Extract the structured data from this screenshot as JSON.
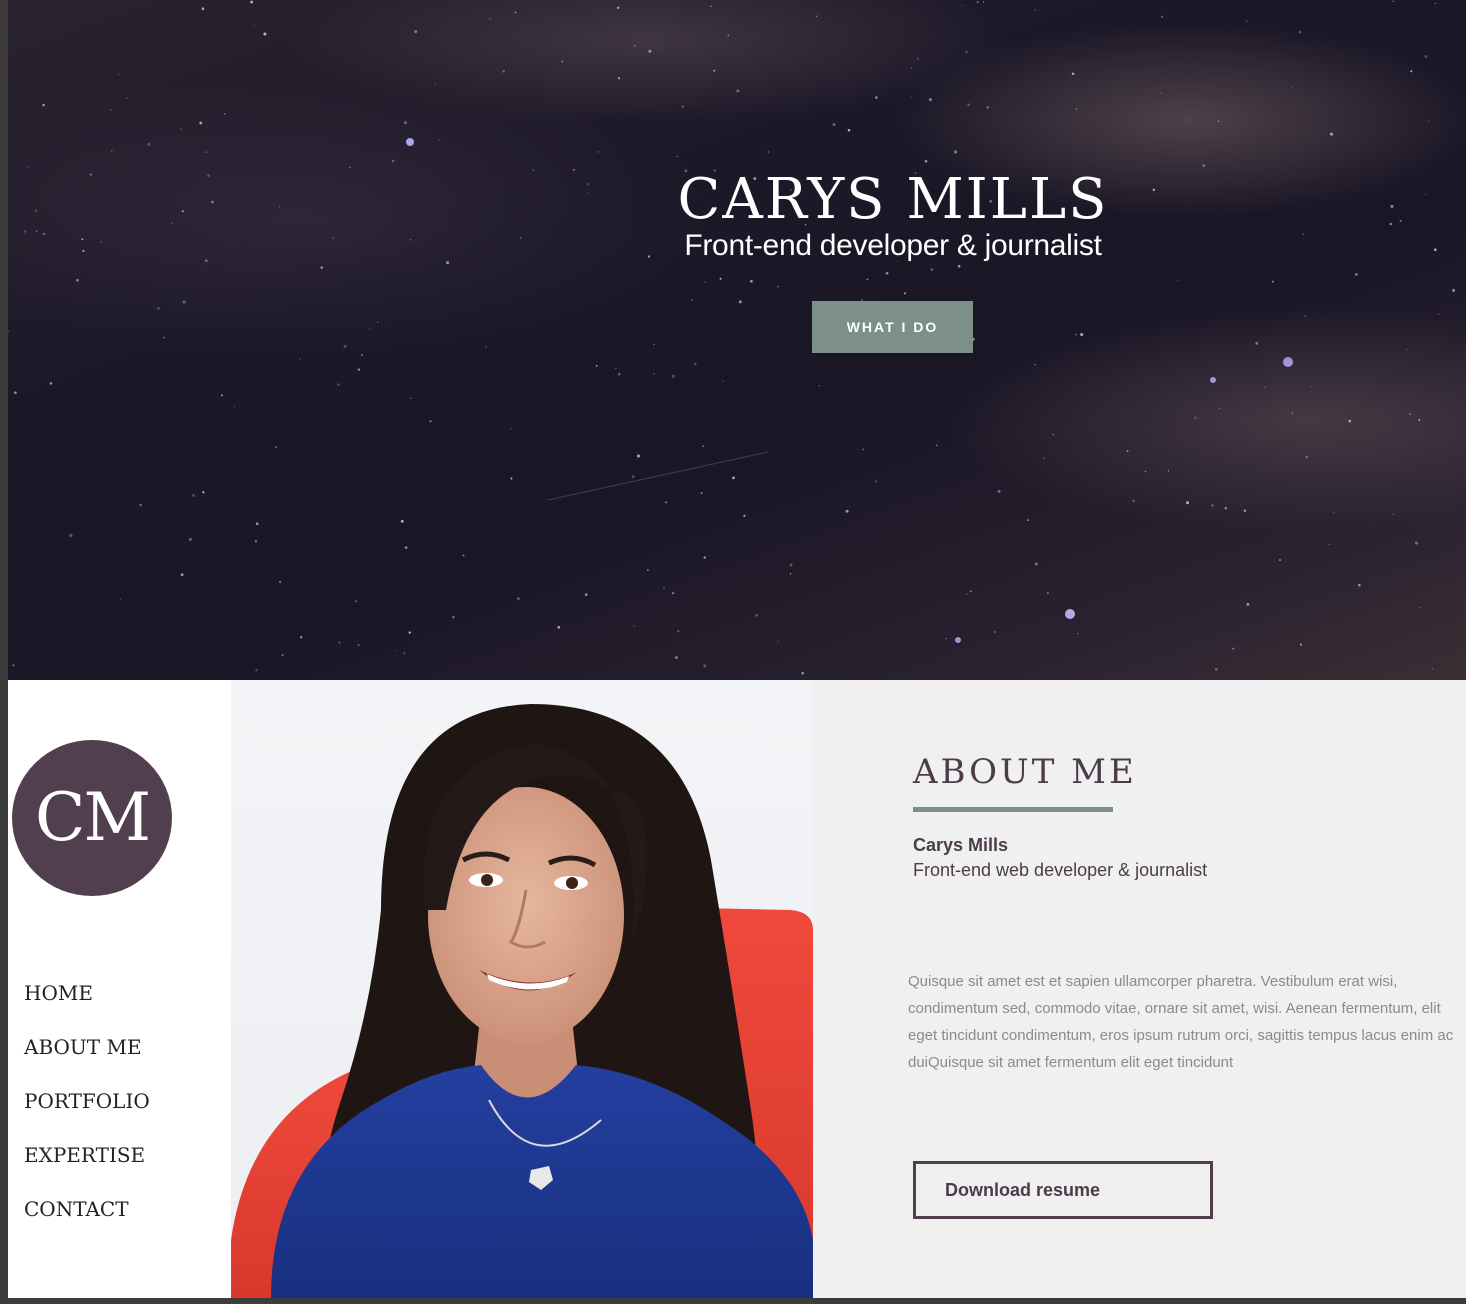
{
  "hero": {
    "title": "CARYS MILLS",
    "subtitle": "Front-end developer & journalist",
    "cta_label": "WHAT I DO"
  },
  "logo": {
    "initials": "CM"
  },
  "nav": {
    "items": [
      {
        "label": "HOME"
      },
      {
        "label": "ABOUT ME"
      },
      {
        "label": "PORTFOLIO"
      },
      {
        "label": "EXPERTISE"
      },
      {
        "label": "CONTACT"
      }
    ]
  },
  "about": {
    "heading": "ABOUT ME",
    "name": "Carys Mills",
    "role": "Front-end web developer & journalist",
    "body": "Quisque sit amet est et sapien ullamcorper pharetra. Vestibulum erat wisi, condimentum sed, commodo vitae, ornare sit amet, wisi. Aenean fermentum, elit eget tincidunt condimentum, eros ipsum rutrum orci, sagittis tempus lacus enim ac duiQuisque sit amet fermentum elit eget tincidunt",
    "resume_label": "Download resume"
  },
  "colors": {
    "accent_sage": "#7d8f89",
    "brand_plum": "#513f4f",
    "text_plum": "#4b3c4a",
    "about_bg": "#f0f0f0",
    "hero_bg": "#1c1828"
  },
  "icons": {
    "profile_photo": "portrait-photo"
  }
}
